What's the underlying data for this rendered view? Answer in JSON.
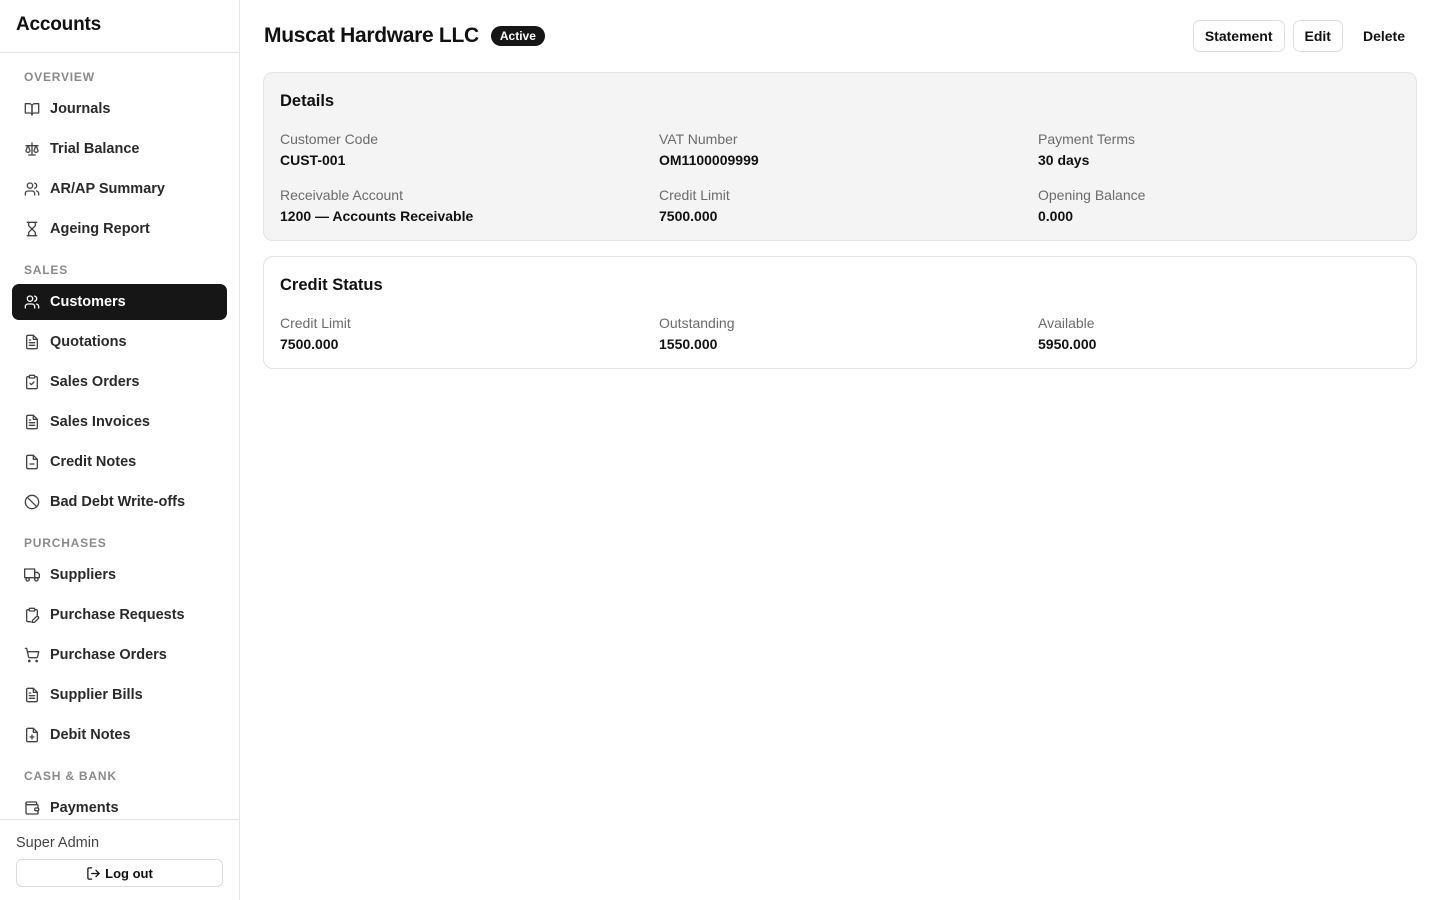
{
  "sidebar": {
    "app_title": "Accounts",
    "sections": [
      {
        "label": "OVERVIEW",
        "items": [
          {
            "label": "Journals",
            "icon": "book-open-icon"
          },
          {
            "label": "Trial Balance",
            "icon": "scale-icon"
          },
          {
            "label": "AR/AP Summary",
            "icon": "users-icon"
          },
          {
            "label": "Ageing Report",
            "icon": "hourglass-icon"
          }
        ]
      },
      {
        "label": "SALES",
        "items": [
          {
            "label": "Customers",
            "icon": "users-icon",
            "active": true
          },
          {
            "label": "Quotations",
            "icon": "file-text-icon"
          },
          {
            "label": "Sales Orders",
            "icon": "clipboard-check-icon"
          },
          {
            "label": "Sales Invoices",
            "icon": "file-text-icon"
          },
          {
            "label": "Credit Notes",
            "icon": "file-minus-icon"
          },
          {
            "label": "Bad Debt Write-offs",
            "icon": "ban-icon"
          }
        ]
      },
      {
        "label": "PURCHASES",
        "items": [
          {
            "label": "Suppliers",
            "icon": "truck-icon"
          },
          {
            "label": "Purchase Requests",
            "icon": "clipboard-pen-icon"
          },
          {
            "label": "Purchase Orders",
            "icon": "shopping-cart-icon"
          },
          {
            "label": "Supplier Bills",
            "icon": "file-text-icon"
          },
          {
            "label": "Debit Notes",
            "icon": "file-plus-icon"
          }
        ]
      },
      {
        "label": "CASH & BANK",
        "items": [
          {
            "label": "Payments",
            "icon": "wallet-icon"
          }
        ]
      }
    ],
    "user_name": "Super Admin",
    "logout_label": "Log out"
  },
  "header": {
    "title": "Muscat Hardware LLC",
    "status": "Active",
    "actions": {
      "statement": "Statement",
      "edit": "Edit",
      "delete": "Delete"
    }
  },
  "details": {
    "title": "Details",
    "fields": [
      {
        "label": "Customer Code",
        "value": "CUST-001"
      },
      {
        "label": "VAT Number",
        "value": "OM1100009999"
      },
      {
        "label": "Payment Terms",
        "value": "30 days"
      },
      {
        "label": "Receivable Account",
        "value": "1200 — Accounts Receivable"
      },
      {
        "label": "Credit Limit",
        "value": "7500.000"
      },
      {
        "label": "Opening Balance",
        "value": "0.000"
      }
    ]
  },
  "credit_status": {
    "title": "Credit Status",
    "fields": [
      {
        "label": "Credit Limit",
        "value": "7500.000"
      },
      {
        "label": "Outstanding",
        "value": "1550.000"
      },
      {
        "label": "Available",
        "value": "5950.000"
      }
    ]
  }
}
